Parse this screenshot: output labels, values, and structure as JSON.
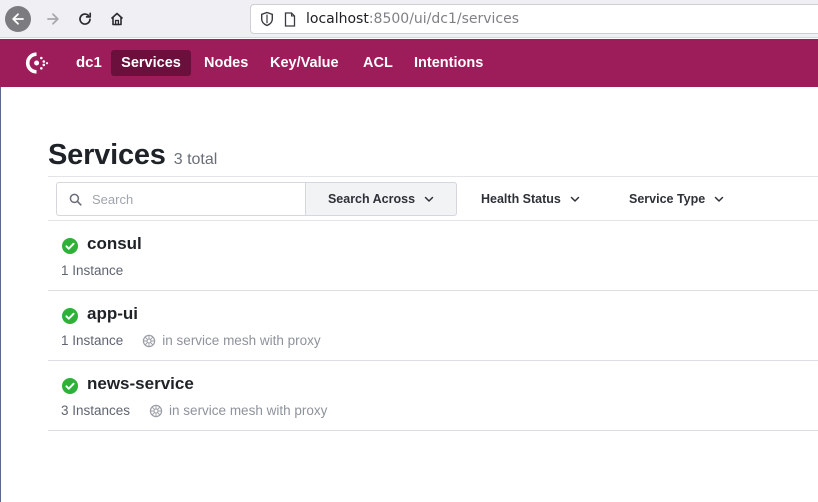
{
  "browser": {
    "url_host": "localhost",
    "url_rest": ":8500/ui/dc1/services"
  },
  "header": {
    "datacenter": "dc1",
    "nav": {
      "services": "Services",
      "nodes": "Nodes",
      "key_value": "Key/Value",
      "acl": "ACL",
      "intentions": "Intentions"
    },
    "active_item": "Services",
    "bg_color": "#9d1d5b",
    "active_color": "#6b0f3c"
  },
  "page": {
    "title": "Services",
    "total": "3 total"
  },
  "filters": {
    "search_placeholder": "Search",
    "search_across": "Search Across",
    "health_status": "Health Status",
    "service_type": "Service Type"
  },
  "services": [
    {
      "name": "consul",
      "instances": "1 Instance",
      "mesh": "",
      "health": "passing",
      "health_icon": "check-circle-icon"
    },
    {
      "name": "app-ui",
      "instances": "1 Instance",
      "mesh": "in service mesh with proxy",
      "health": "passing",
      "health_icon": "check-circle-icon"
    },
    {
      "name": "news-service",
      "instances": "3 Instances",
      "mesh": "in service mesh with proxy",
      "health": "passing",
      "health_icon": "check-circle-icon"
    }
  ],
  "colors": {
    "passing": "#2eb039"
  }
}
